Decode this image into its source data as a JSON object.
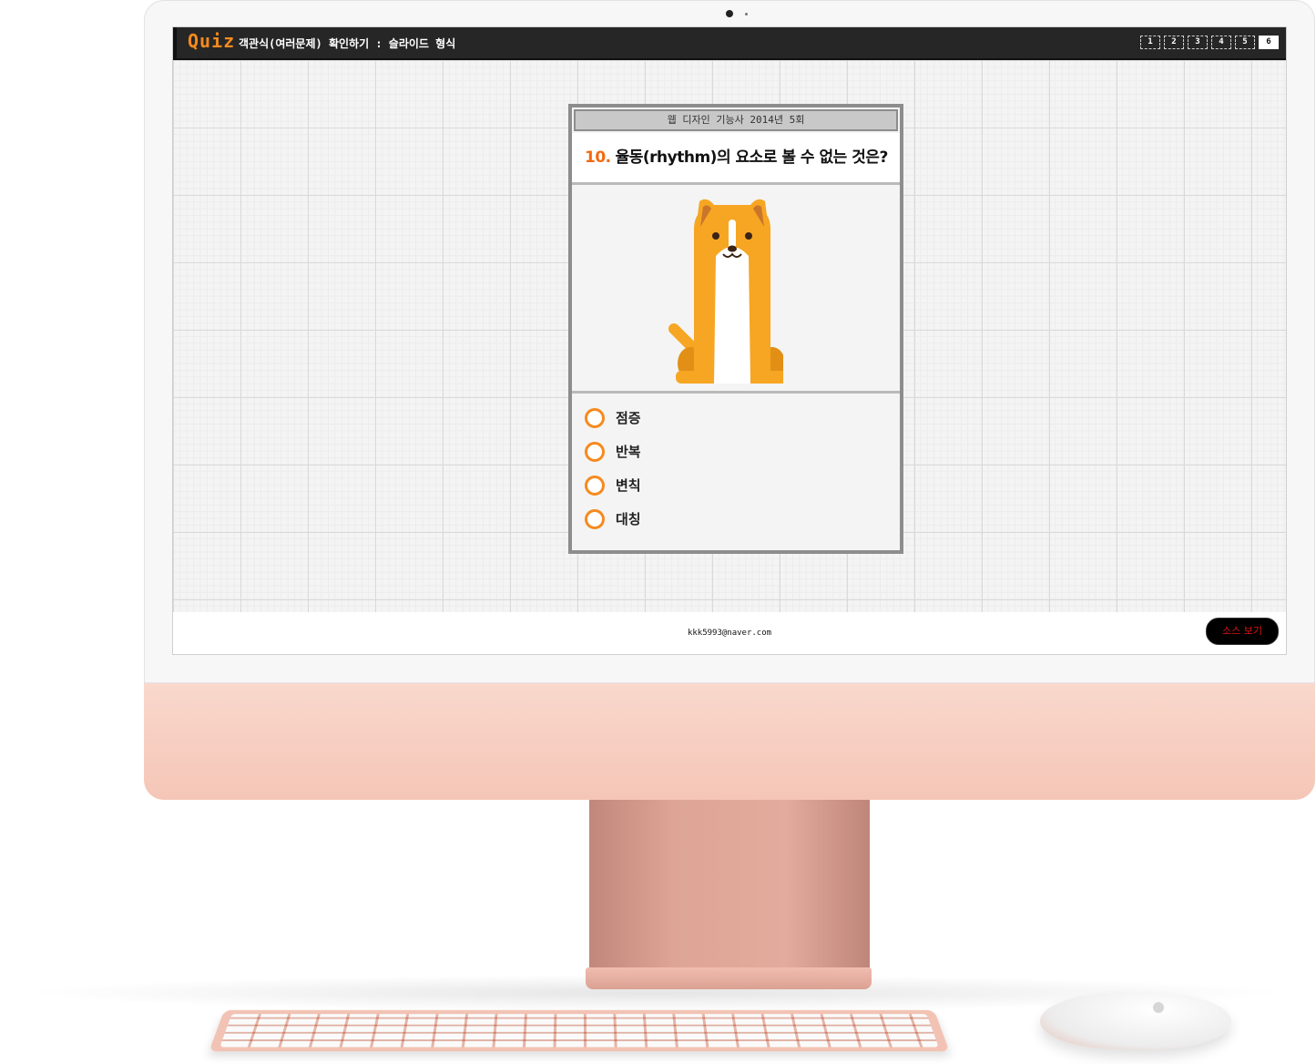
{
  "header": {
    "logo": "Quiz",
    "title": "객관식(여러문제) 확인하기 : 슬라이드 형식",
    "pages": [
      "1",
      "2",
      "3",
      "4",
      "5",
      "6"
    ],
    "active_page": "6"
  },
  "quiz": {
    "source": "웹 디자인 기능사 2014년 5회",
    "number": "10.",
    "question": "율동(rhythm)의 요소로 볼 수 없는 것은?",
    "image": "dog-illustration",
    "options": [
      "점증",
      "반복",
      "변칙",
      "대칭"
    ]
  },
  "footer": {
    "email": "kkk5993@naver.com",
    "source_button": "소스 보기"
  },
  "colors": {
    "accent": "#f68a1e",
    "topbar": "#262626",
    "source_button_text": "#e21212"
  }
}
